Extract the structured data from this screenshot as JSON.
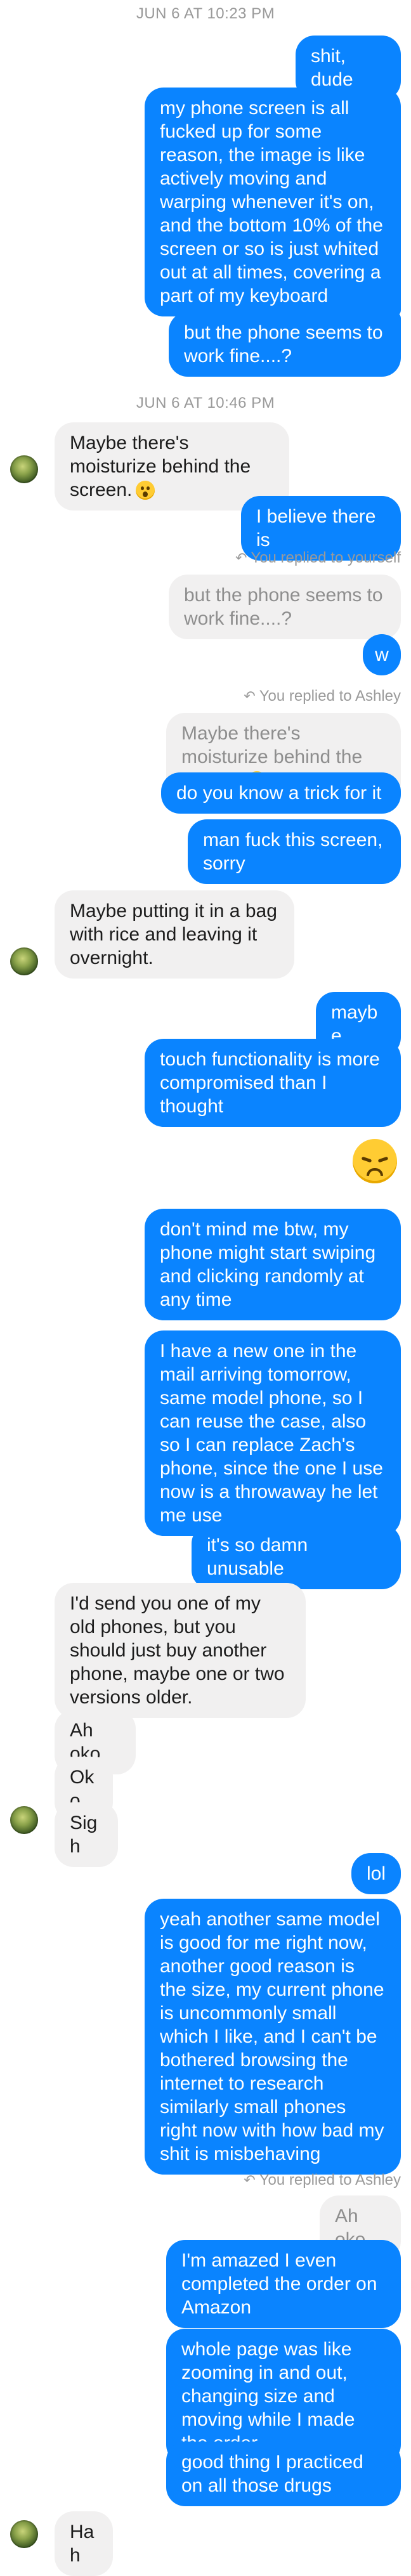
{
  "timestamps": [
    "JUN 6 AT 10:23 PM",
    "JUN 6 AT 10:46 PM"
  ],
  "reply_notes": [
    "You replied to yourself",
    "You replied to Ashley",
    "You replied to Ashley"
  ],
  "messages": [
    "shit, dude",
    "my phone screen is all fucked up for some reason, the image is like actively moving and warping whenever it's on, and the bottom 10% of the screen or so is just whited out at all times, covering a part of my keyboard",
    "but the phone seems to work fine....?",
    "Maybe there's moisturize behind the screen.",
    "I believe there is",
    "but the phone seems to work fine....?",
    "w",
    "Maybe there's moisturize behind the screen.",
    "do you know a trick for it",
    "man fuck this screen, sorry",
    "Maybe putting it in a bag with rice and leaving it overnight.",
    "maybe",
    "touch functionality is more compromised than I thought",
    "don't mind me btw, my phone might start swiping and clicking randomly at any time",
    "I have a new one in the mail arriving tomorrow, same model phone, so I can reuse the case, also so I can replace Zach's phone, since the one I use now is a throwaway he let me use",
    "it's so damn unusable",
    "I'd send you one of my old phones, but you should just buy another phone, maybe one or two versions older.",
    "Ah oko",
    "Oko",
    "Sigh",
    "lol",
    "yeah another same model is good for me right now, another good reason is the size, my current phone is uncommonly small which I like, and I can't be bothered browsing the internet to research similarly small phones right now with how bad my shit is misbehaving",
    "Ah oko",
    "I'm amazed I even completed the order on Amazon",
    "whole page was like zooming in and out, changing size and moving while I made the order",
    "good thing I practiced on all those drugs",
    "Hah"
  ],
  "colors": {
    "outgoing": "#0a84ff",
    "incoming": "#f1f0f0",
    "timestamp": "#9a9a9a"
  },
  "icons": {
    "reaction_emoji": "disappointed-face-emoji",
    "inline_emoji": "surprised-face-emoji"
  }
}
